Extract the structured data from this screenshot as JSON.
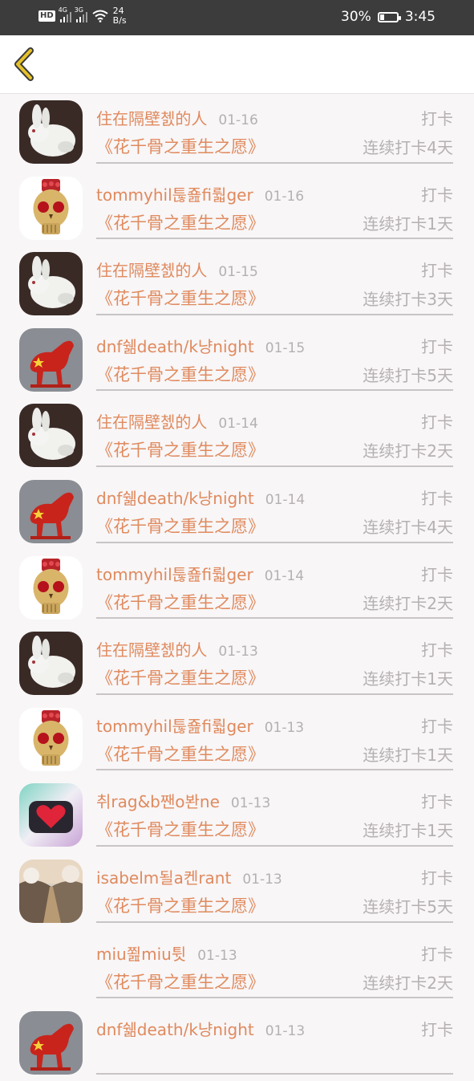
{
  "status_bar": {
    "network_hd": "HD",
    "signal1_label": "4G",
    "signal2_label": "3G",
    "speed_value": "24",
    "speed_unit": "B/s",
    "battery_percent": "30%",
    "battery_level": 0.3,
    "time": "3:45"
  },
  "header": {
    "back_icon": "chevron-left-icon",
    "accent_color": "#e6c12a"
  },
  "records": [
    {
      "avatar": "rabbit",
      "name": "住在隔壁쳀的人",
      "date": "01-16",
      "action": "打卡",
      "book": "《花千骨之重生之愿》",
      "streak": "连续打卡4天"
    },
    {
      "avatar": "skull",
      "name": "tommyhil툲죮fi뤏ger",
      "date": "01-16",
      "action": "打卡",
      "book": "《花千骨之重生之愿》",
      "streak": "连续打卡1天"
    },
    {
      "avatar": "rabbit",
      "name": "住在隔壁쳀的人",
      "date": "01-15",
      "action": "打卡",
      "book": "《花千骨之重生之愿》",
      "streak": "连续打卡3天"
    },
    {
      "avatar": "horse",
      "name": "dnf쉚death/k냥night",
      "date": "01-15",
      "action": "打卡",
      "book": "《花千骨之重生之愿》",
      "streak": "连续打卡5天"
    },
    {
      "avatar": "rabbit",
      "name": "住在隔壁쳀的人",
      "date": "01-14",
      "action": "打卡",
      "book": "《花千骨之重生之愿》",
      "streak": "连续打卡2天"
    },
    {
      "avatar": "horse",
      "name": "dnf쉚death/k냥night",
      "date": "01-14",
      "action": "打卡",
      "book": "《花千骨之重生之愿》",
      "streak": "连续打卡4天"
    },
    {
      "avatar": "skull",
      "name": "tommyhil툲죮fi뤏ger",
      "date": "01-14",
      "action": "打卡",
      "book": "《花千骨之重生之愿》",
      "streak": "连续打卡2天"
    },
    {
      "avatar": "rabbit",
      "name": "住在隔壁쳀的人",
      "date": "01-13",
      "action": "打卡",
      "book": "《花千骨之重生之愿》",
      "streak": "连续打卡1天"
    },
    {
      "avatar": "skull",
      "name": "tommyhil툲죮fi뤏ger",
      "date": "01-13",
      "action": "打卡",
      "book": "《花千骨之重生之愿》",
      "streak": "连续打卡1天"
    },
    {
      "avatar": "heart",
      "name": "취rag&b짼o봔ne",
      "date": "01-13",
      "action": "打卡",
      "book": "《花千骨之重生之愿》",
      "streak": "连续打卡1天"
    },
    {
      "avatar": "road",
      "name": "isabelm될a켄rant",
      "date": "01-13",
      "action": "打卡",
      "book": "《花千骨之重生之愿》",
      "streak": "连续打卡5天"
    },
    {
      "avatar": "none",
      "name": "miu쬞miu튓",
      "date": "01-13",
      "action": "打卡",
      "book": "《花千骨之重生之愿》",
      "streak": "连续打卡2天"
    },
    {
      "avatar": "horse",
      "name": "dnf쉚death/k냥night",
      "date": "01-13",
      "action": "打卡",
      "book": "",
      "streak": ""
    }
  ]
}
